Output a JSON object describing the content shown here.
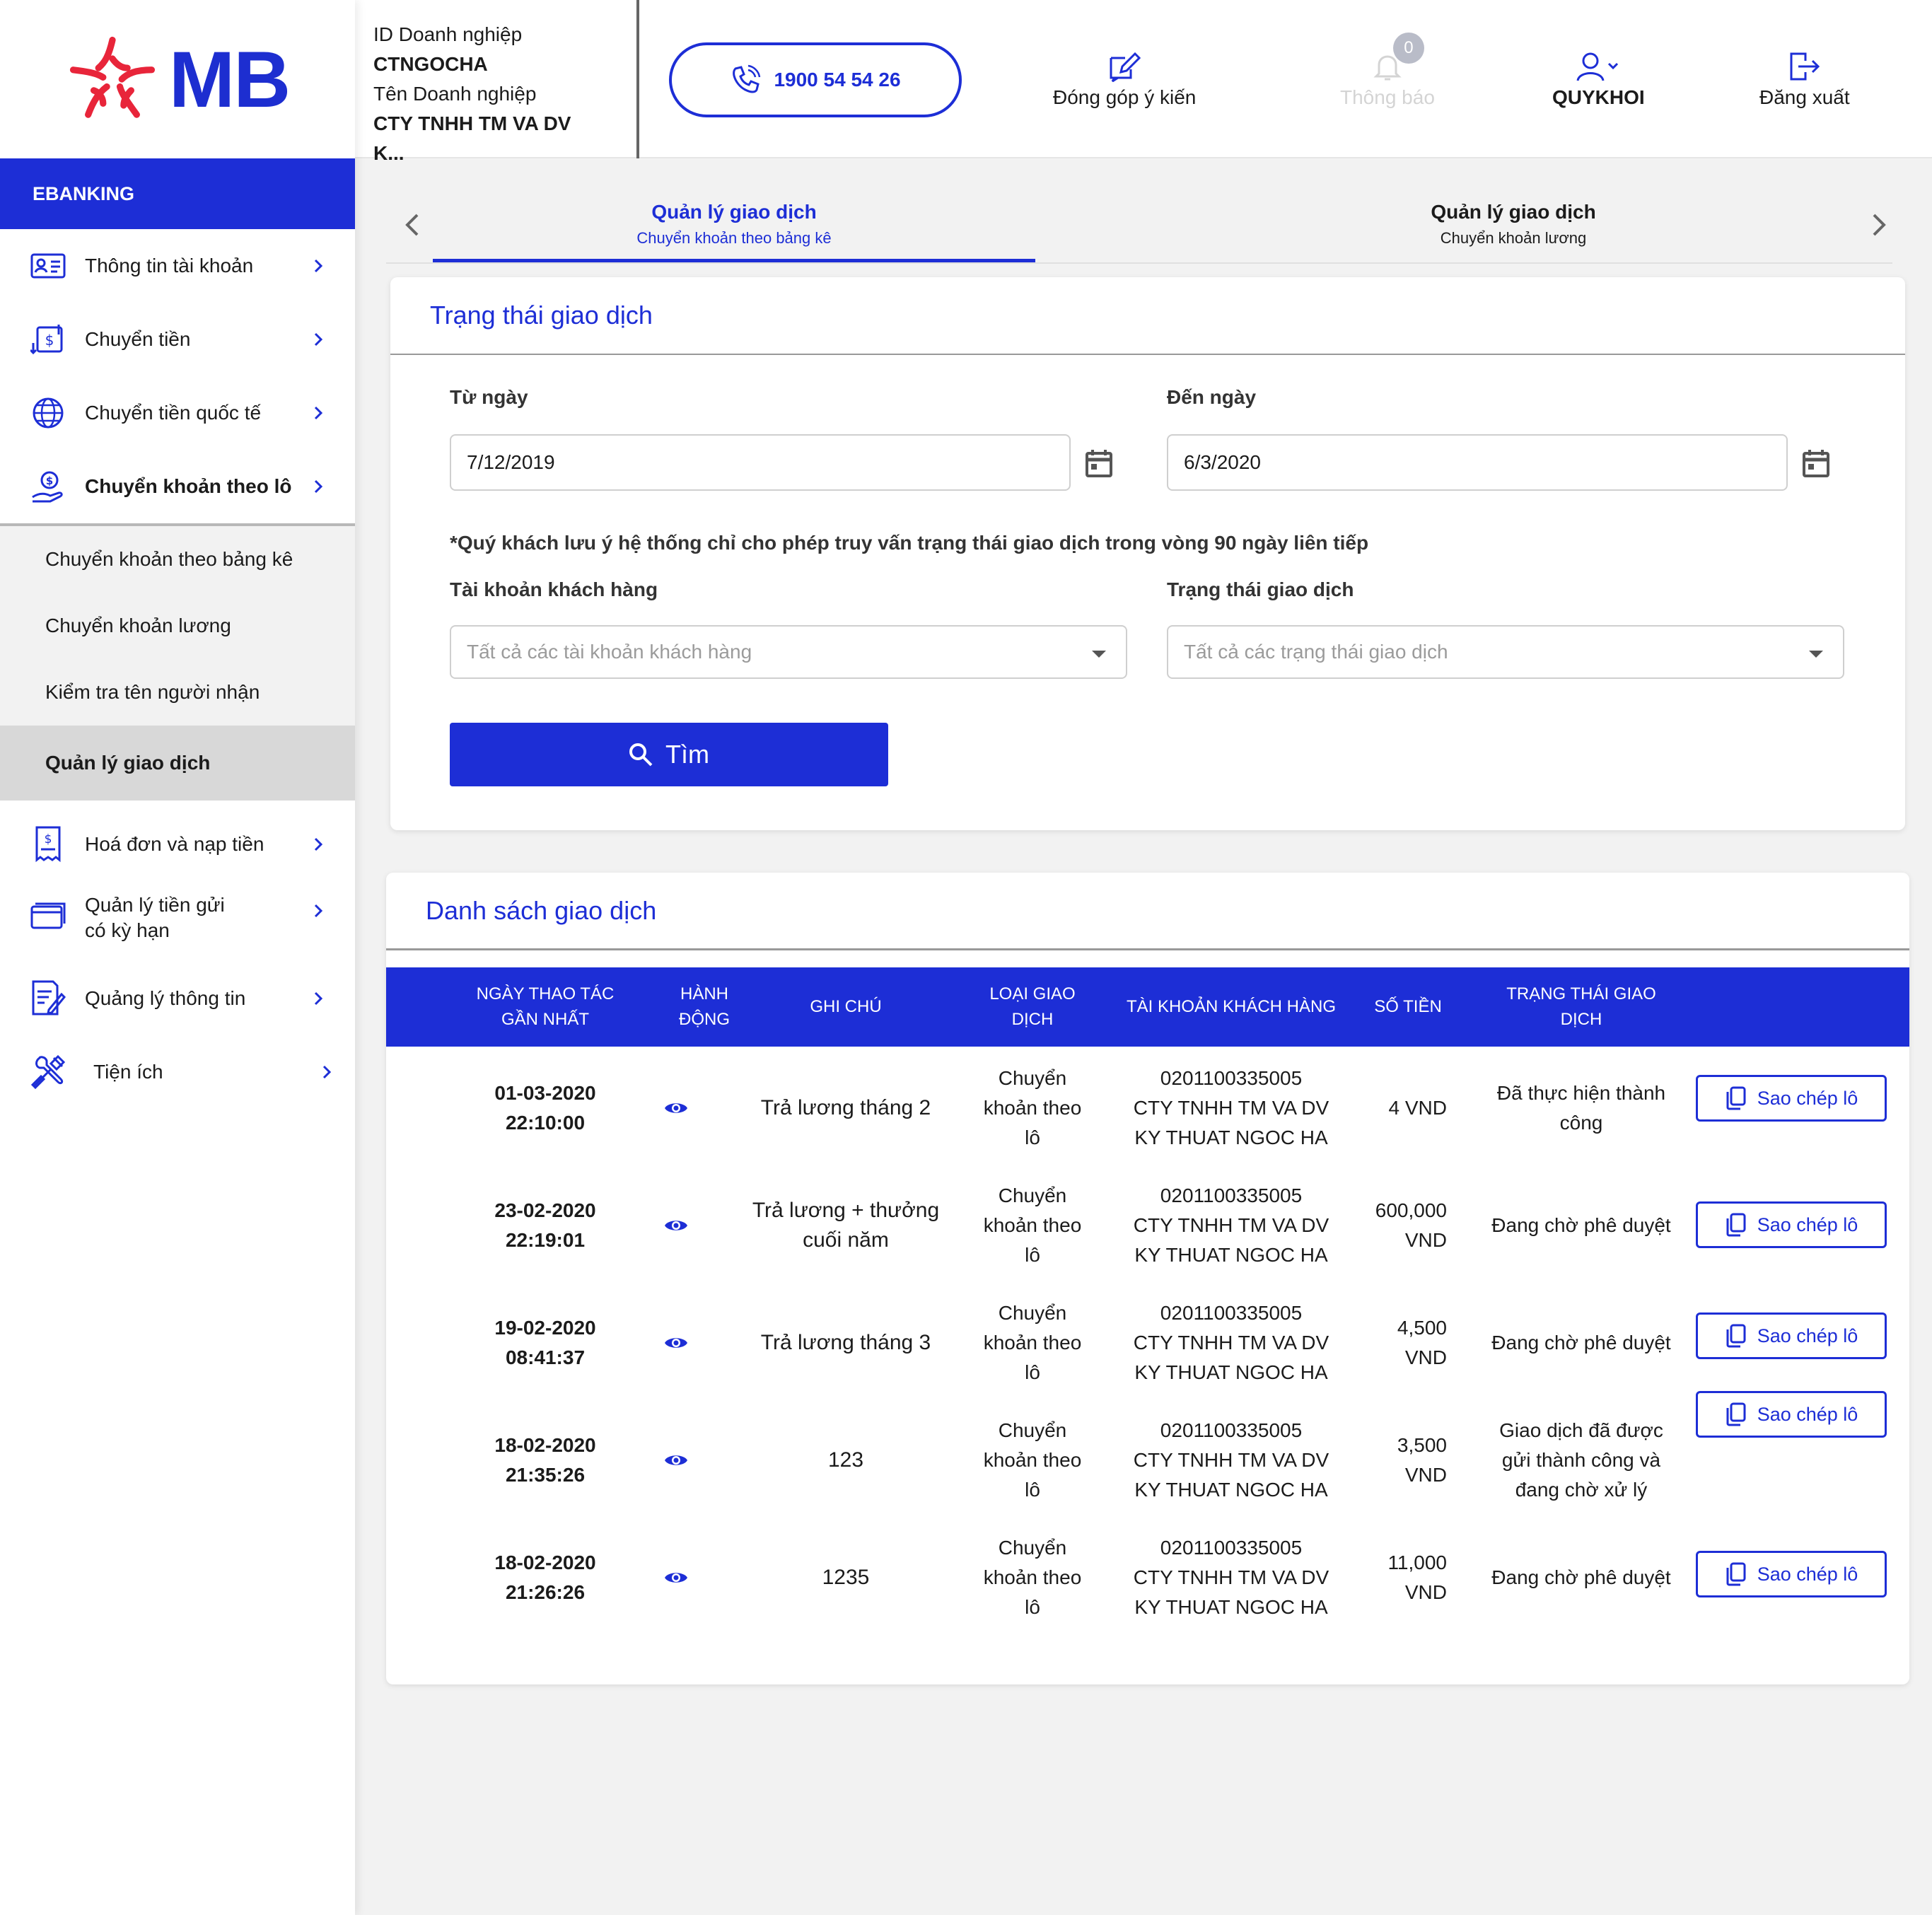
{
  "brand": {
    "logo_text": "MB",
    "accent": "#1d2ed6",
    "logo_red": "#e8253a"
  },
  "company": {
    "id_label": "ID Doanh nghiệp",
    "id_value": "CTNGOCHA",
    "name_label": "Tên Doanh nghiệp",
    "name_value": "CTY TNHH TM VA DV K..."
  },
  "header": {
    "hotline": "1900 54 54 26",
    "feedback": "Đóng góp ý kiến",
    "notifications": "Thông báo",
    "notification_count": "0",
    "user": "QUYKHOI",
    "logout": "Đăng xuất"
  },
  "sidebar": {
    "section": "EBANKING",
    "items": [
      {
        "label": "Thông tin tài khoản",
        "icon": "id-card-icon"
      },
      {
        "label": "Chuyển tiền",
        "icon": "transfer-icon"
      },
      {
        "label": "Chuyển tiền quốc tế",
        "icon": "globe-icon"
      },
      {
        "label": "Chuyển khoản theo lô",
        "icon": "hand-coin-icon"
      }
    ],
    "subitems": [
      {
        "label": "Chuyển khoản theo bảng kê"
      },
      {
        "label": "Chuyển khoản lương"
      },
      {
        "label": "Kiểm tra tên người nhận"
      },
      {
        "label": "Quản lý giao dịch"
      }
    ],
    "items2": [
      {
        "label": "Hoá đơn và nạp tiền",
        "icon": "receipt-icon"
      },
      {
        "label_line1": "Quản lý tiền gửi",
        "label_line2": "có kỳ hạn",
        "icon": "card-icon"
      },
      {
        "label": "Quảng lý thông tin",
        "icon": "document-edit-icon"
      },
      {
        "label": "Tiện ích",
        "icon": "tools-icon"
      }
    ]
  },
  "tabs": [
    {
      "title": "Quản lý giao dịch",
      "subtitle": "Chuyển khoản theo bảng kê"
    },
    {
      "title": "Quản lý giao dịch",
      "subtitle": "Chuyển khoản lương"
    }
  ],
  "filter": {
    "title": "Trạng thái giao dịch",
    "from_label": "Từ ngày",
    "from_value": "7/12/2019",
    "to_label": "Đến ngày",
    "to_value": "6/3/2020",
    "note": "*Quý khách lưu ý hệ thống chỉ cho phép truy vấn trạng thái giao dịch trong vòng 90 ngày liên tiếp",
    "account_label": "Tài khoản khách hàng",
    "account_placeholder": "Tất cả các tài khoản khách hàng",
    "status_label": "Trạng thái giao dịch",
    "status_placeholder": "Tất cả các trạng thái giao dịch",
    "search_button": "Tìm"
  },
  "list": {
    "title": "Danh sách giao dịch",
    "headers": {
      "date_l1": "NGÀY THAO TÁC",
      "date_l2": "GẦN NHẤT",
      "action_l1": "HÀNH",
      "action_l2": "ĐỘNG",
      "note": "GHI CHÚ",
      "type_l1": "LOẠI GIAO",
      "type_l2": "DỊCH",
      "account": "TÀI KHOẢN KHÁCH HÀNG",
      "amount": "SỐ TIỀN",
      "status_l1": "TRẠNG THÁI GIAO",
      "status_l2": "DỊCH"
    },
    "copy_label": "Sao chép lô",
    "rows": [
      {
        "date": "01-03-2020",
        "time": "22:10:00",
        "note_l1": "Trả lương tháng  2",
        "note_l2": "",
        "type_l1": "Chuyển",
        "type_l2": "khoản theo",
        "type_l3": "lô",
        "acc_l1": "0201100335005",
        "acc_l2": "CTY TNHH TM VA DV",
        "acc_l3": "KY THUAT NGOC HA",
        "amount_l1": "4 VND",
        "amount_l2": "",
        "status_l1": "Đã thực hiện thành",
        "status_l2": "công",
        "status_l3": ""
      },
      {
        "date": "23-02-2020",
        "time": "22:19:01",
        "note_l1": "Trả lương + thưởng",
        "note_l2": "cuối năm",
        "type_l1": "Chuyển",
        "type_l2": "khoản theo",
        "type_l3": "lô",
        "acc_l1": "0201100335005",
        "acc_l2": "CTY TNHH TM VA DV",
        "acc_l3": "KY THUAT NGOC HA",
        "amount_l1": "600,000",
        "amount_l2": "VND",
        "status_l1": "Đang chờ phê duyệt",
        "status_l2": "",
        "status_l3": ""
      },
      {
        "date": "19-02-2020",
        "time": "08:41:37",
        "note_l1": "Trả lương tháng  3",
        "note_l2": "",
        "type_l1": "Chuyển",
        "type_l2": "khoản theo",
        "type_l3": "lô",
        "acc_l1": "0201100335005",
        "acc_l2": "CTY TNHH TM VA DV",
        "acc_l3": "KY THUAT NGOC HA",
        "amount_l1": "4,500",
        "amount_l2": "VND",
        "status_l1": "Đang chờ phê duyệt",
        "status_l2": "",
        "status_l3": ""
      },
      {
        "date": "18-02-2020",
        "time": "21:35:26",
        "note_l1": "123",
        "note_l2": "",
        "type_l1": "Chuyển",
        "type_l2": "khoản theo",
        "type_l3": "lô",
        "acc_l1": "0201100335005",
        "acc_l2": "CTY TNHH TM VA DV",
        "acc_l3": "KY THUAT NGOC HA",
        "amount_l1": "3,500",
        "amount_l2": "VND",
        "status_l1": "Giao dịch đã được",
        "status_l2": "gửi thành công và",
        "status_l3": "đang chờ xử lý"
      },
      {
        "date": "18-02-2020",
        "time": "21:26:26",
        "note_l1": "1235",
        "note_l2": "",
        "type_l1": "Chuyển",
        "type_l2": "khoản theo",
        "type_l3": "lô",
        "acc_l1": "0201100335005",
        "acc_l2": "CTY TNHH TM VA DV",
        "acc_l3": "KY THUAT NGOC HA",
        "amount_l1": "11,000",
        "amount_l2": "VND",
        "status_l1": "Đang chờ phê duyệt",
        "status_l2": "",
        "status_l3": ""
      }
    ]
  }
}
